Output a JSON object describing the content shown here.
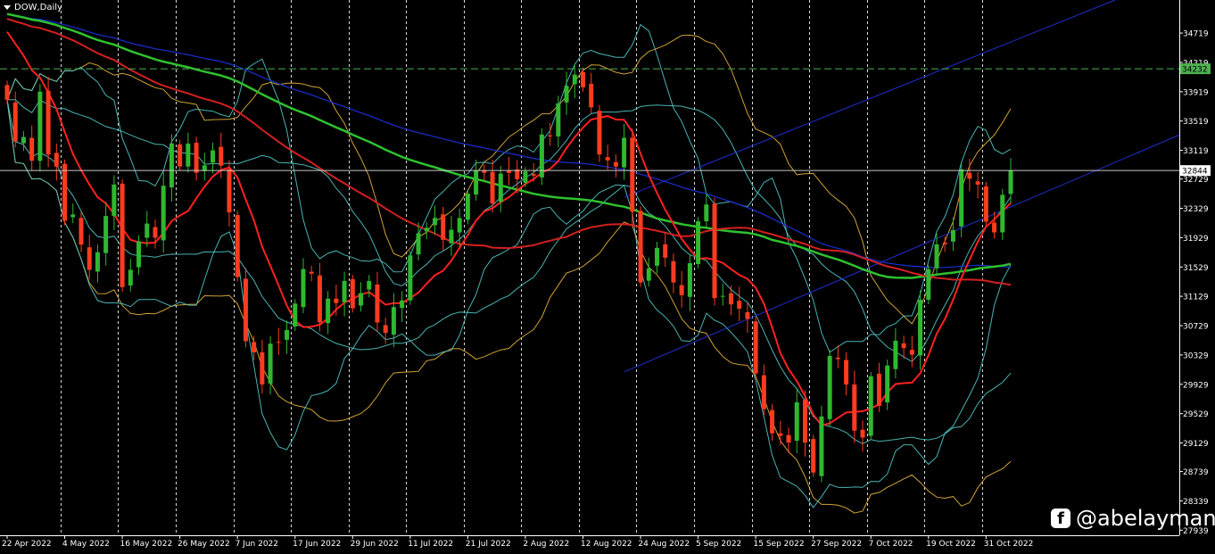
{
  "symbol": "DOW,Daily",
  "watermark": {
    "icon": "facebook-icon",
    "handle": "@abelayman"
  },
  "colors": {
    "background": "#000000",
    "bull": "#2fb82f",
    "bear": "#ff3b1f",
    "ma_fast": "#ff2020",
    "ma_mid": "#d42020",
    "ma_slow": "#2ec12e",
    "ma_blue": "#1a2fd6",
    "band_inner": "#52c6c6",
    "band_outer": "#e6b43a",
    "channel": "#1f2fd0",
    "level": "#4caf50",
    "current": "#c8c8c8"
  },
  "chart_data": {
    "type": "candlestick",
    "y_ticks": [
      34719,
      34319,
      33919,
      33519,
      33119,
      32729,
      32329,
      31929,
      31529,
      31129,
      30729,
      30329,
      29929,
      29529,
      29129,
      28739,
      28339,
      27939
    ],
    "ylim": [
      27870,
      35170
    ],
    "x_labels": [
      "22 Apr 2022",
      "4 May 2022",
      "16 May 2022",
      "26 May 2022",
      "7 Jun 2022",
      "17 Jun 2022",
      "29 Jun 2022",
      "11 Jul 2022",
      "21 Jul 2022",
      "2 Aug 2022",
      "12 Aug 2022",
      "24 Aug 2022",
      "5 Sep 2022",
      "15 Sep 2022",
      "27 Sep 2022",
      "7 Oct 2022",
      "19 Oct 2022",
      "31 Oct 2022"
    ],
    "level_line": {
      "label": "34232",
      "value": 34232
    },
    "current_price": {
      "label": "32844",
      "value": 32844
    },
    "grid": "vertical dashed",
    "close": [
      33810,
      33240,
      33302,
      32977,
      33920,
      33061,
      32899,
      32160,
      32245,
      31834,
      31490,
      31730,
      32224,
      32654,
      31253,
      31490,
      31880,
      32121,
      31928,
      32637,
      33213,
      32899,
      33212,
      32813,
      32916,
      33120,
      32910,
      32273,
      31392,
      30517,
      30364,
      29927,
      30483,
      30500,
      30670,
      31030,
      31500,
      31438,
      30775,
      31097,
      31037,
      31339,
      30967,
      31173,
      31338,
      30772,
      30630,
      30982,
      31073,
      31688,
      31990,
      32063,
      32198,
      31900,
      32036,
      32197,
      32529,
      32845,
      32813,
      32396,
      32803,
      32812,
      32726,
      32832,
      32774,
      33336,
      33309,
      33761,
      33999,
      34152,
      33980,
      33706,
      33063,
      32983,
      32899,
      33291,
      32283,
      31318,
      31510,
      31790,
      31656,
      31318,
      31145,
      31581,
      32152,
      32381,
      31104,
      31135,
      31019,
      30961,
      30822,
      30076,
      29590,
      29260,
      29225,
      29135,
      29683,
      29134,
      28725,
      29490,
      30316,
      30273,
      29926,
      29297,
      29202,
      30038,
      29634,
      30185,
      30523,
      30423,
      30333,
      31082,
      31499,
      31837,
      31839,
      32033,
      32861,
      32732,
      32653,
      32147,
      32001,
      32513,
      32844
    ]
  }
}
